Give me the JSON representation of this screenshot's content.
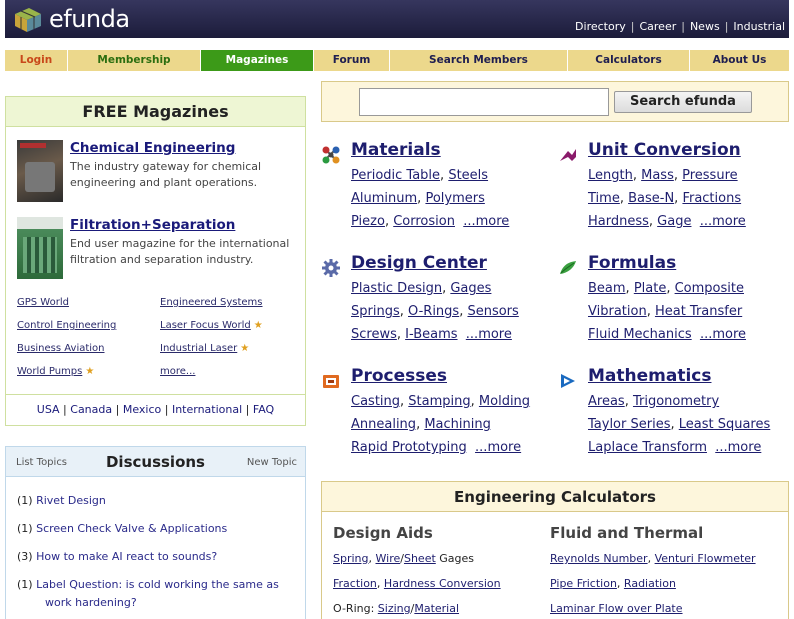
{
  "header": {
    "logo": "efunda",
    "links": [
      "Directory",
      "Career",
      "News",
      "Industrial"
    ]
  },
  "nav": {
    "login": "Login",
    "membership": "Membership",
    "magazines": "Magazines",
    "forum": "Forum",
    "search_members": "Search Members",
    "calculators": "Calculators",
    "about_us": "About Us"
  },
  "magazines": {
    "title": "FREE Magazines",
    "items": [
      {
        "title": "Chemical Engineering",
        "desc": "The industry gateway for chemical engineering and plant operations."
      },
      {
        "title": "Filtration+Separation",
        "desc": "End user magazine for the international filtration and separation industry."
      }
    ],
    "links_left": [
      "GPS World",
      "Control Engineering",
      "Business Aviation",
      "World Pumps"
    ],
    "links_right": [
      "Engineered Systems",
      "Laser Focus World",
      "Industrial Laser",
      "more..."
    ],
    "regions": [
      "USA",
      "Canada",
      "Mexico",
      "International",
      "FAQ"
    ]
  },
  "discussions": {
    "list_topics": "List Topics",
    "title": "Discussions",
    "new_topic": "New Topic",
    "items": [
      {
        "count": "(1)",
        "text": "Rivet Design"
      },
      {
        "count": "(1)",
        "text": "Screen Check Valve & Applications"
      },
      {
        "count": "(3)",
        "text": "How to make AI react to sounds?"
      },
      {
        "count": "(1)",
        "text": "Label Question: is cold working the same as work hardening?"
      }
    ]
  },
  "search": {
    "button": "Search efunda",
    "value": ""
  },
  "sections": {
    "materials": {
      "title": "Materials",
      "rows": [
        [
          "Periodic Table",
          "Steels"
        ],
        [
          "Aluminum",
          "Polymers"
        ],
        [
          "Piezo",
          "Corrosion",
          "...more"
        ]
      ]
    },
    "unit_conversion": {
      "title": "Unit Conversion",
      "rows": [
        [
          "Length",
          "Mass",
          "Pressure"
        ],
        [
          "Time",
          "Base-N",
          "Fractions"
        ],
        [
          "Hardness",
          "Gage",
          "...more"
        ]
      ]
    },
    "design_center": {
      "title": "Design Center",
      "rows": [
        [
          "Plastic Design",
          "Gages"
        ],
        [
          "Springs",
          "O-Rings",
          "Sensors"
        ],
        [
          "Screws",
          "I-Beams",
          "...more"
        ]
      ]
    },
    "formulas": {
      "title": "Formulas",
      "rows": [
        [
          "Beam",
          "Plate",
          "Composite"
        ],
        [
          "Vibration",
          "Heat Transfer"
        ],
        [
          "Fluid Mechanics",
          "...more"
        ]
      ]
    },
    "processes": {
      "title": "Processes",
      "rows": [
        [
          "Casting",
          "Stamping",
          "Molding"
        ],
        [
          "Annealing",
          "Machining"
        ],
        [
          "Rapid Prototyping",
          "...more"
        ]
      ]
    },
    "mathematics": {
      "title": "Mathematics",
      "rows": [
        [
          "Areas",
          "Trigonometry"
        ],
        [
          "Taylor Series",
          "Least Squares"
        ],
        [
          "Laplace Transform",
          "...more"
        ]
      ]
    }
  },
  "calculators": {
    "title": "Engineering Calculators",
    "design_aids": {
      "title": "Design Aids",
      "spring": "Spring",
      "wire": "Wire",
      "sheet": "Sheet",
      "gages": " Gages",
      "fraction": "Fraction",
      "hardness": "Hardness Conversion",
      "oring_label": "O-Ring: ",
      "sizing": "Sizing",
      "material": "Material"
    },
    "fluid_thermal": {
      "title": "Fluid and Thermal",
      "reynolds": "Reynolds Number",
      "venturi": "Venturi Flowmeter",
      "pipe": "Pipe Friction",
      "radiation": "Radiation",
      "laminar": "Laminar Flow over Plate"
    }
  },
  "colors": {
    "header_bg": "#2a2a4c",
    "nav_bg": "#ecd88c",
    "nav_active": "#3c9a18",
    "link": "#1e1e6e"
  }
}
